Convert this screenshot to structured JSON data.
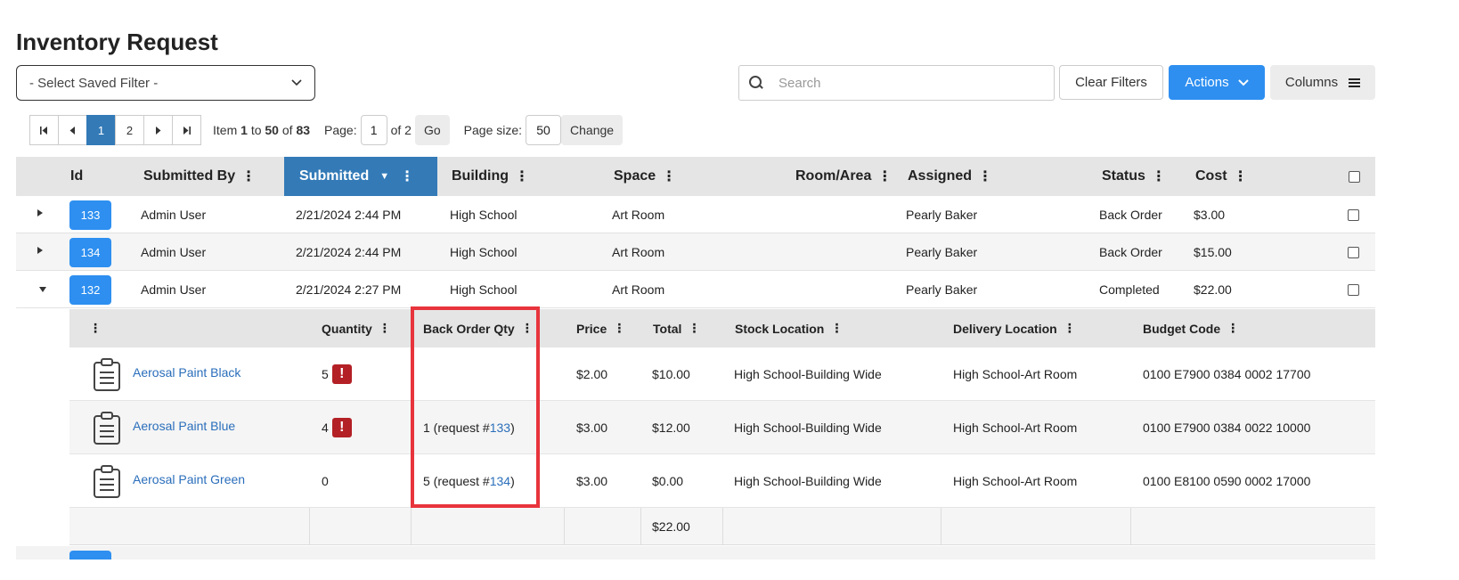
{
  "page": {
    "title": "Inventory Request",
    "saved_filter": "- Select Saved Filter -",
    "search_placeholder": "Search",
    "clear_filters": "Clear Filters",
    "actions": "Actions",
    "columns": "Columns"
  },
  "pager": {
    "pages": [
      "1",
      "2"
    ],
    "item_prefix": "Item",
    "item_from": "1",
    "item_to_word": "to",
    "item_to": "50",
    "item_of_word": "of",
    "item_total": "83",
    "page_label": "Page:",
    "page_value": "1",
    "page_of": "of 2",
    "go": "Go",
    "size_label": "Page size:",
    "size_value": "50",
    "change": "Change"
  },
  "grid": {
    "headers": {
      "id": "Id",
      "submitted_by": "Submitted By",
      "submitted": "Submitted",
      "building": "Building",
      "space": "Space",
      "room": "Room/Area",
      "assigned": "Assigned",
      "status": "Status",
      "cost": "Cost"
    },
    "rows": [
      {
        "id": "133",
        "submitted_by": "Admin User",
        "submitted": "2/21/2024 2:44 PM",
        "building": "High School",
        "space": "Art Room",
        "room": "",
        "assigned": "Pearly Baker",
        "status": "Back Order",
        "cost": "$3.00"
      },
      {
        "id": "134",
        "submitted_by": "Admin User",
        "submitted": "2/21/2024 2:44 PM",
        "building": "High School",
        "space": "Art Room",
        "room": "",
        "assigned": "Pearly Baker",
        "status": "Back Order",
        "cost": "$15.00"
      },
      {
        "id": "132",
        "submitted_by": "Admin User",
        "submitted": "2/21/2024 2:27 PM",
        "building": "High School",
        "space": "Art Room",
        "room": "",
        "assigned": "Pearly Baker",
        "status": "Completed",
        "cost": "$22.00"
      }
    ]
  },
  "detail": {
    "headers": {
      "quantity": "Quantity",
      "back_order": "Back Order Qty",
      "price": "Price",
      "total": "Total",
      "stock": "Stock Location",
      "delivery": "Delivery Location",
      "budget": "Budget Code"
    },
    "rows": [
      {
        "item": "Aerosal Paint Black",
        "quantity": "5",
        "warn": "!",
        "bo_text": "",
        "bo_link": "",
        "bo_close": "",
        "price": "$2.00",
        "total": "$10.00",
        "stock": "High School-Building Wide",
        "delivery": "High School-Art Room",
        "budget": "0100 E7900 0384 0002 17700"
      },
      {
        "item": "Aerosal Paint Blue",
        "quantity": "4",
        "warn": "!",
        "bo_text": "1 (request #",
        "bo_link": "133",
        "bo_close": ")",
        "price": "$3.00",
        "total": "$12.00",
        "stock": "High School-Building Wide",
        "delivery": "High School-Art Room",
        "budget": "0100 E7900 0384 0022 10000"
      },
      {
        "item": "Aerosal Paint Green",
        "quantity": "0",
        "warn": "",
        "bo_text": "5 (request #",
        "bo_link": "134",
        "bo_close": ")",
        "price": "$3.00",
        "total": "$0.00",
        "stock": "High School-Building Wide",
        "delivery": "High School-Art Room",
        "budget": "0100 E8100 0590 0002 17000"
      }
    ],
    "footer_total": "$22.00"
  },
  "icons": {
    "kebab": "⋮",
    "sort_desc": "▼",
    "chevron": "⌄"
  },
  "colors": {
    "primary": "#2e8ff0",
    "sorted_header": "#337ab7",
    "link": "#2a6ebb",
    "warning": "#b32025",
    "highlight": "#e8343c"
  }
}
